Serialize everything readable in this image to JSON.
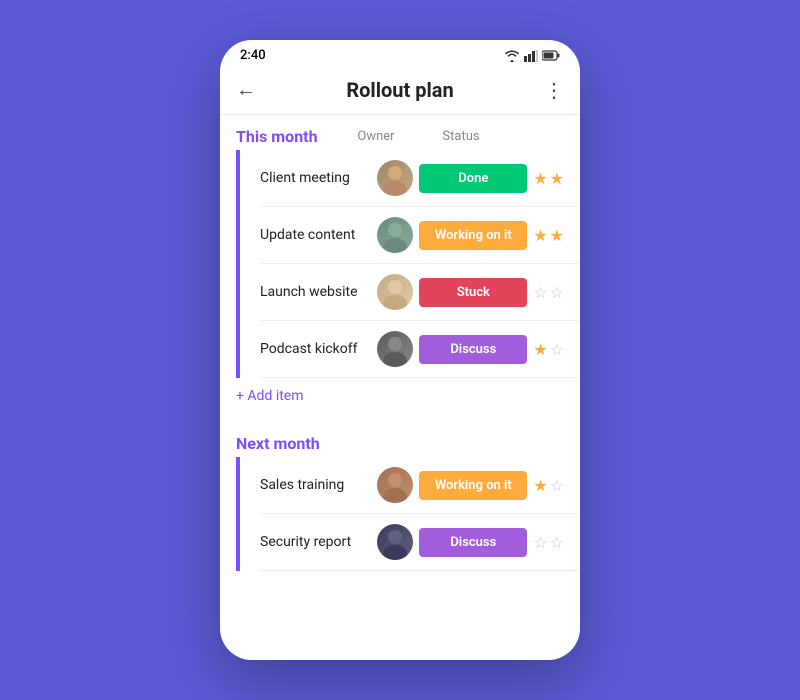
{
  "statusBar": {
    "time": "2:40"
  },
  "header": {
    "title": "Rollout plan",
    "back": "←",
    "menu": "⋮"
  },
  "sections": [
    {
      "id": "this-month",
      "title": "This month",
      "columns": {
        "owner": "Owner",
        "status": "Status"
      },
      "tasks": [
        {
          "name": "Client meeting",
          "avatarClass": "avatar-1",
          "status": "Done",
          "statusClass": "status-done",
          "stars": [
            true,
            true
          ]
        },
        {
          "name": "Update content",
          "avatarClass": "avatar-2",
          "status": "Working on it",
          "statusClass": "status-working",
          "stars": [
            true,
            true
          ]
        },
        {
          "name": "Launch website",
          "avatarClass": "avatar-3",
          "status": "Stuck",
          "statusClass": "status-stuck",
          "stars": [
            false,
            false
          ]
        },
        {
          "name": "Podcast kickoff",
          "avatarClass": "avatar-4",
          "status": "Discuss",
          "statusClass": "status-discuss",
          "stars": [
            true,
            false
          ]
        }
      ],
      "addLabel": "+ Add item"
    },
    {
      "id": "next-month",
      "title": "Next month",
      "tasks": [
        {
          "name": "Sales training",
          "avatarClass": "avatar-5",
          "status": "Working on it",
          "statusClass": "status-working",
          "stars": [
            true,
            false
          ]
        },
        {
          "name": "Security report",
          "avatarClass": "avatar-6",
          "status": "Discuss",
          "statusClass": "status-discuss",
          "stars": [
            false,
            false
          ]
        }
      ]
    }
  ]
}
